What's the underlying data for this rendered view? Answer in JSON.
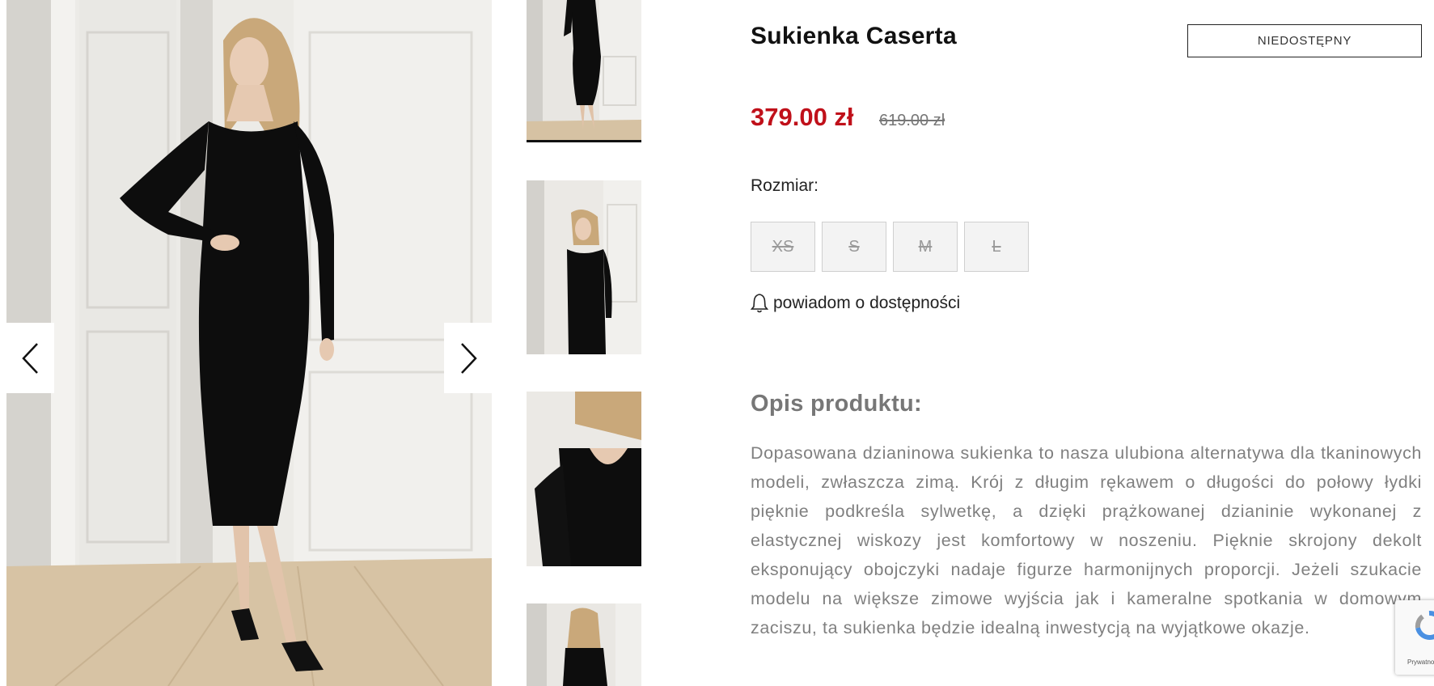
{
  "gallery": {
    "prev_label": "previous",
    "next_label": "next"
  },
  "product": {
    "title": "Sukienka Caserta",
    "availability": "NIEDOSTĘPNY",
    "price": "379.00 zł",
    "old_price": "619.00 zł",
    "size_label": "Rozmiar:",
    "sizes": [
      "XS",
      "S",
      "M",
      "L"
    ],
    "notify_label": "powiadom o dostępności",
    "description_heading": "Opis produktu:",
    "description": "Dopasowana dzianinowa sukienka to nasza ulubiona alternatywa dla tkaninowych modeli, zwłaszcza zimą. Krój z długim rękawem o długości do połowy łydki pięknie podkreśla sylwetkę, a dzięki prążkowanej dzianinie wykonanej z elastycznej wiskozy jest komfortowy w noszeniu. Pięknie skrojony dekolt eksponujący obojczyki nadaje figurze harmonijnych proporcji. Jeżeli szukacie modelu na większe zimowe wyjścia jak i kameralne spotkania w domowym zaciszu, ta sukienka będzie idealną inwestycją na wyjątkowe okazje."
  },
  "recaptcha": {
    "label": "Prywatność"
  },
  "colors": {
    "price": "#c0101a",
    "text": "#222222",
    "muted": "#808080"
  }
}
